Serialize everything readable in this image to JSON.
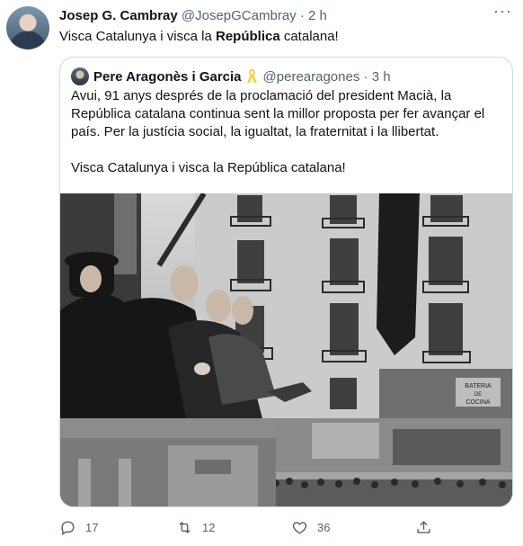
{
  "tweet": {
    "author_name": "Josep G. Cambray",
    "handle": "@JosepGCambray",
    "separator": "·",
    "time": "2 h",
    "more": "···",
    "text_before": "Visca Catalunya i visca la ",
    "text_bold": "República",
    "text_after": " catalana!"
  },
  "quote": {
    "author_name": "Pere Aragonès i Garcia",
    "handle": "@perearagones",
    "separator": "·",
    "time": "3 h",
    "paragraph1": "Avui, 91 anys després de la proclamació del president Macià, la República catalana continua sent la millor proposta per fer avançar el país. Per la justícia social, la igualtat, la fraternitat i la llibertat.",
    "paragraph2": "Visca Catalunya i visca la República catalana!",
    "photo_signs": {
      "sign1_line1": "BATERIA",
      "sign1_line2": "DE",
      "sign1_line3": "COCINA"
    }
  },
  "actions": {
    "reply_count": "17",
    "retweet_count": "12",
    "like_count": "36"
  },
  "colors": {
    "text": "#0f1419",
    "muted": "#536471",
    "border": "#cfd9de",
    "ribbon": "#f4d03f"
  }
}
